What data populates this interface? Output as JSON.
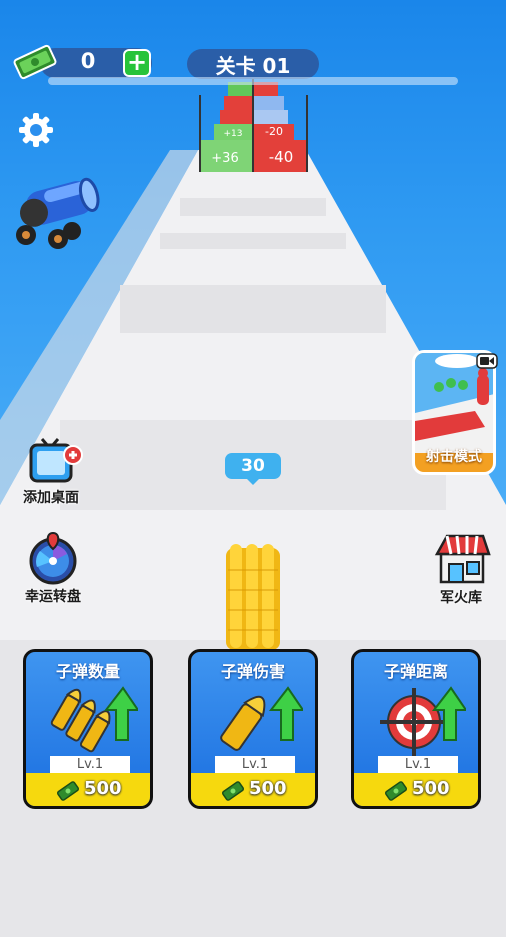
{
  "hud": {
    "cash": "0",
    "add_symbol": "+",
    "level": "关卡 01"
  },
  "track_gates": [
    {
      "left": "+36",
      "right": "-40"
    },
    {
      "left": "+13",
      "right": "-20"
    }
  ],
  "bullet_count": "30",
  "side_buttons": {
    "add_desktop": "添加桌面",
    "lucky_wheel": "幸运转盘",
    "shooting_mode": "射击模式",
    "armory": "军火库"
  },
  "upgrades": [
    {
      "title": "子弹数量",
      "level": "Lv.1",
      "price": "500"
    },
    {
      "title": "子弹伤害",
      "level": "Lv.1",
      "price": "500"
    },
    {
      "title": "子弹距离",
      "level": "Lv.1",
      "price": "500"
    }
  ],
  "colors": {
    "sky": "#2f9af2",
    "road": "#f0f0f2",
    "gate_positive": "#61c75a",
    "gate_negative": "#e3403a",
    "card_blue": "#2a7fe8",
    "price_yellow": "#f6d90e"
  }
}
